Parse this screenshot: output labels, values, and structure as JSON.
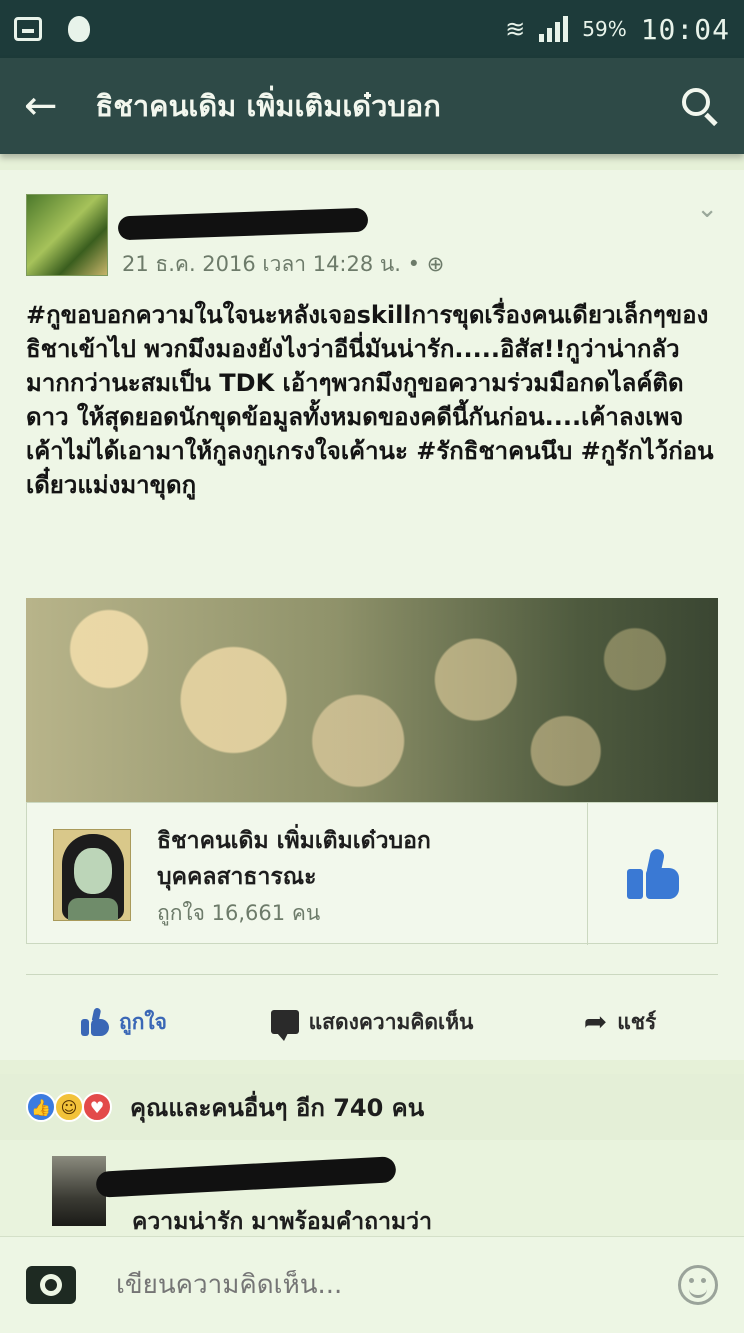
{
  "status_bar": {
    "battery": "59%",
    "time": "10:04"
  },
  "app_bar": {
    "back_icon": "arrow-left-icon",
    "title": "ธิชาคนเดิม  เพิ่มเติมเด๋วบอก",
    "search_icon": "search-icon"
  },
  "post": {
    "timestamp": "21 ธ.ค. 2016 เวลา 14:28 น. • ",
    "privacy_icon": "globe-icon",
    "text": "#กูขอบอกความในใจนะหลังเจอskillการขุดเรื่องคนเดียวเล็กๆของธิชาเข้าไป พวกมึงมองยังไงว่าอีนี่มันน่ารัก.....อิสัส!!กูว่าน่ากลัวมากกว่านะสมเป็น TDK เอ้าๆพวกมึงกูขอความร่วมมือกดไลค์ติดดาว ให้สุดยอดนักขุดข้อมูลทั้งหมดของคดีนี้กันก่อน....เค้าลงเพจเค้าไม่ได้เอามาให้กูลงกูเกรงใจเค้านะ #รักธิชาคนนึบ #กูรักไว้ก่อนเดี๋ยวแม่งมาขุดกู",
    "shared_page": {
      "name": "ธิชาคนเดิม  เพิ่มเติมเด๋วบอก",
      "category": "บุคคลสาธารณะ",
      "likes": "ถูกใจ 16,661 คน"
    }
  },
  "actions": {
    "like": "ถูกใจ",
    "comment": "แสดงความคิดเห็น",
    "share": "แชร์"
  },
  "reactions": {
    "text": "คุณและคนอื่นๆ อีก 740 คน"
  },
  "comment": {
    "text": "ความน่ารัก มาพร้อมคำถามว่า"
  },
  "composer": {
    "placeholder": "เขียนความคิดเห็น..."
  }
}
